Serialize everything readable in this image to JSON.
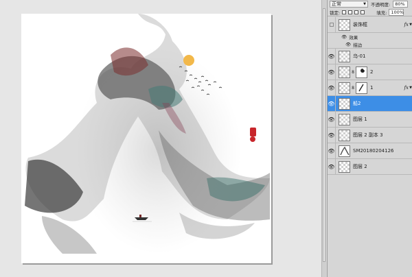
{
  "panel": {
    "blend_mode": "正常",
    "opacity_label": "不透明度:",
    "opacity_value": "80%",
    "lock_label": "锁定:",
    "fill_label": "填充:",
    "fill_value": "100%"
  },
  "layers": [
    {
      "name": "装饰框",
      "visible": false,
      "fx": "fx"
    },
    {
      "name": "乌-01",
      "visible": true
    },
    {
      "name": "2",
      "visible": true
    },
    {
      "name": "1",
      "visible": true,
      "fx": "fx"
    },
    {
      "name": "船2",
      "visible": true,
      "selected": true
    },
    {
      "name": "图层 1",
      "visible": true
    },
    {
      "name": "图层 2 副本 3",
      "visible": true
    },
    {
      "name": "SM20180204126",
      "visible": true
    },
    {
      "name": "图层 2",
      "visible": true
    }
  ],
  "effects": {
    "label": "效果",
    "item": "描边"
  },
  "colors": {
    "selected": "#3d8ee6",
    "sun": "#f2b84a",
    "seal": "#c8262b"
  },
  "icons": {
    "eye": "eye-icon",
    "chain": "link-icon",
    "fx": "fx-icon"
  }
}
